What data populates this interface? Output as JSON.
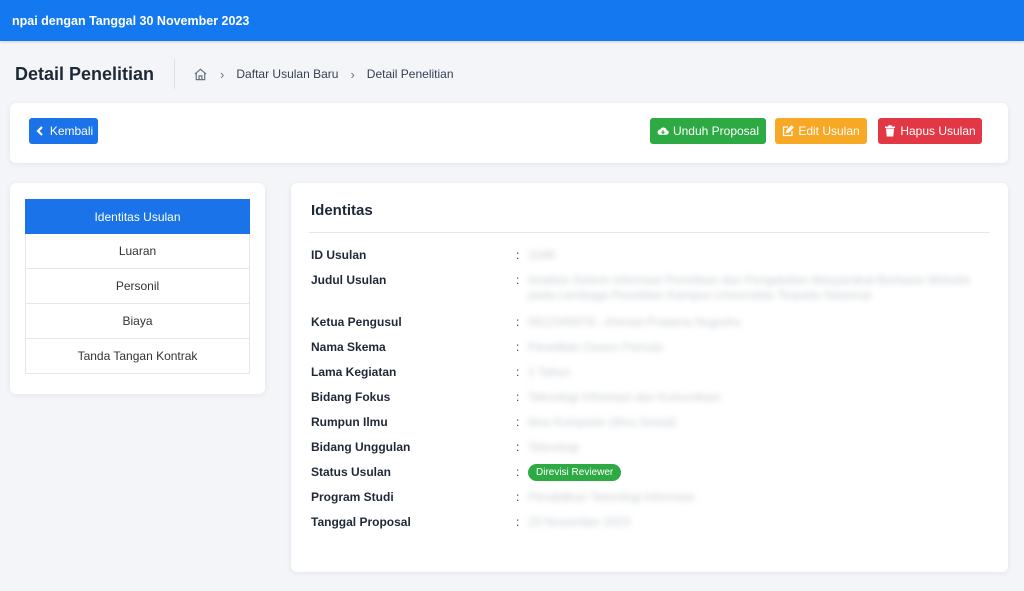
{
  "topbar": {
    "text": "npai dengan Tanggal 30 November 2023"
  },
  "header": {
    "title": "Detail Penelitian",
    "breadcrumbs": [
      "Daftar Usulan Baru",
      "Detail Penelitian"
    ]
  },
  "actions": {
    "back": "Kembali",
    "download": "Unduh Proposal",
    "edit": "Edit Usulan",
    "delete": "Hapus Usulan"
  },
  "sidebar": {
    "items": [
      {
        "label": "Identitas Usulan"
      },
      {
        "label": "Luaran"
      },
      {
        "label": "Personil"
      },
      {
        "label": "Biaya"
      },
      {
        "label": "Tanda Tangan Kontrak"
      }
    ]
  },
  "identitas": {
    "title": "Identitas",
    "colon": ":",
    "rows": [
      {
        "label": "ID Usulan",
        "value": "1048"
      },
      {
        "label": "Judul Usulan",
        "value": "Analisis Sistem Informasi Penelitian dan Pengabdian Masyarakat Berbasis Website pada Lembaga Penelitian Kampus Universitas Terpadu Nasional"
      },
      {
        "label": "Ketua Pengusul",
        "value": "0012345678 - Ahmad Pratama Nugroho"
      },
      {
        "label": "Nama Skema",
        "value": "Penelitian Dosen Pemula"
      },
      {
        "label": "Lama Kegiatan",
        "value": "1 Tahun"
      },
      {
        "label": "Bidang Fokus",
        "value": "Teknologi Informasi dan Komunikasi"
      },
      {
        "label": "Rumpun Ilmu",
        "value": "Ilmu Komputer (Ilmu Sosial)"
      },
      {
        "label": "Bidang Unggulan",
        "value": "Teknologi"
      },
      {
        "label": "Status Usulan",
        "value": "Direvisi Reviewer"
      },
      {
        "label": "Program Studi",
        "value": "Pendidikan Teknologi Informasi"
      },
      {
        "label": "Tanggal Proposal",
        "value": "23 November 2023"
      }
    ]
  },
  "colors": {
    "topbar": "#1478f0",
    "primary": "#1a73e8",
    "success": "#2eaa45",
    "warning": "#f7a824",
    "danger": "#e23845"
  },
  "icons": {
    "home": "home-icon",
    "back": "chevron-left-icon",
    "download": "cloud-download-icon",
    "edit": "edit-icon",
    "delete": "trash-icon"
  }
}
